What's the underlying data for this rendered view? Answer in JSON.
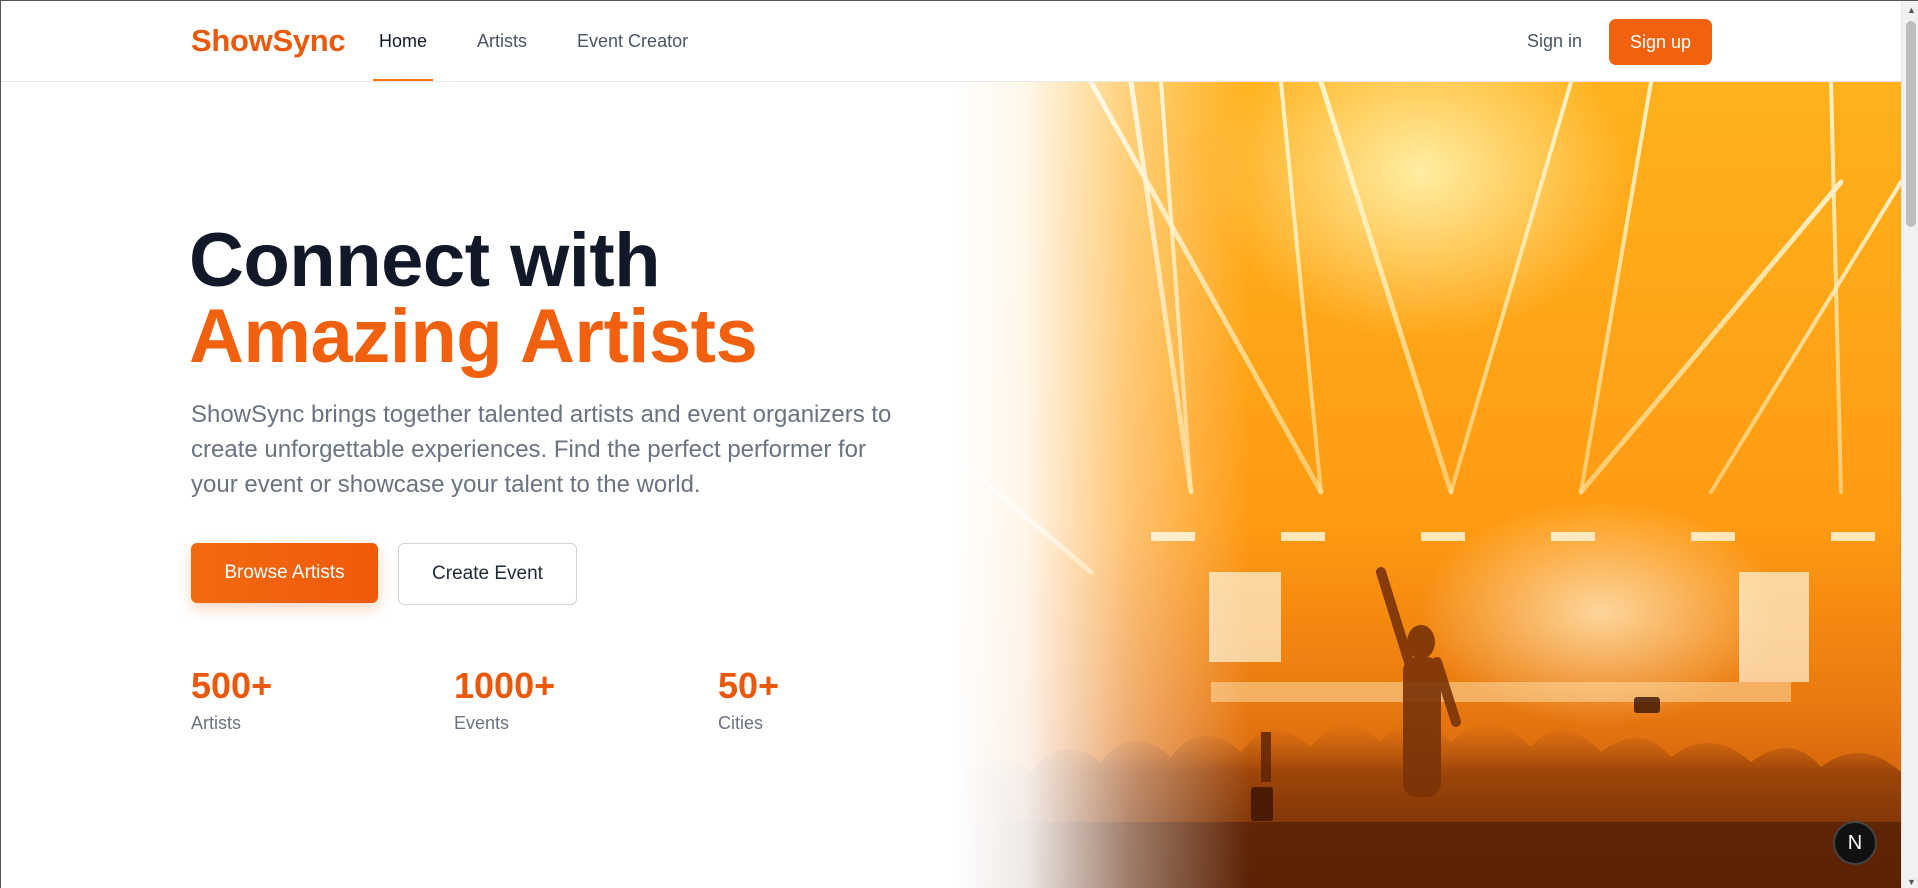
{
  "brand": {
    "name": "ShowSync"
  },
  "nav": {
    "links": [
      {
        "label": "Home"
      },
      {
        "label": "Artists"
      },
      {
        "label": "Event Creator"
      }
    ],
    "signin_label": "Sign in",
    "signup_label": "Sign up"
  },
  "hero": {
    "title_line1": "Connect with",
    "title_line2": "Amazing Artists",
    "lead": "ShowSync brings together talented artists and event organizers to create unforgettable experiences. Find the perfect performer for your event or showcase your talent to the world.",
    "primary_button": "Browse Artists",
    "secondary_button": "Create Event",
    "image_subject": "concert-crowd-photo"
  },
  "stats": [
    {
      "value": "500+",
      "label": "Artists"
    },
    {
      "value": "1000+",
      "label": "Events"
    },
    {
      "value": "50+",
      "label": "Cities"
    }
  ],
  "dev_badge": {
    "letter": "N",
    "icon": "nextjs-icon"
  },
  "colors": {
    "accent": "#f0620f",
    "heading": "#111827",
    "muted": "#6b7280"
  }
}
